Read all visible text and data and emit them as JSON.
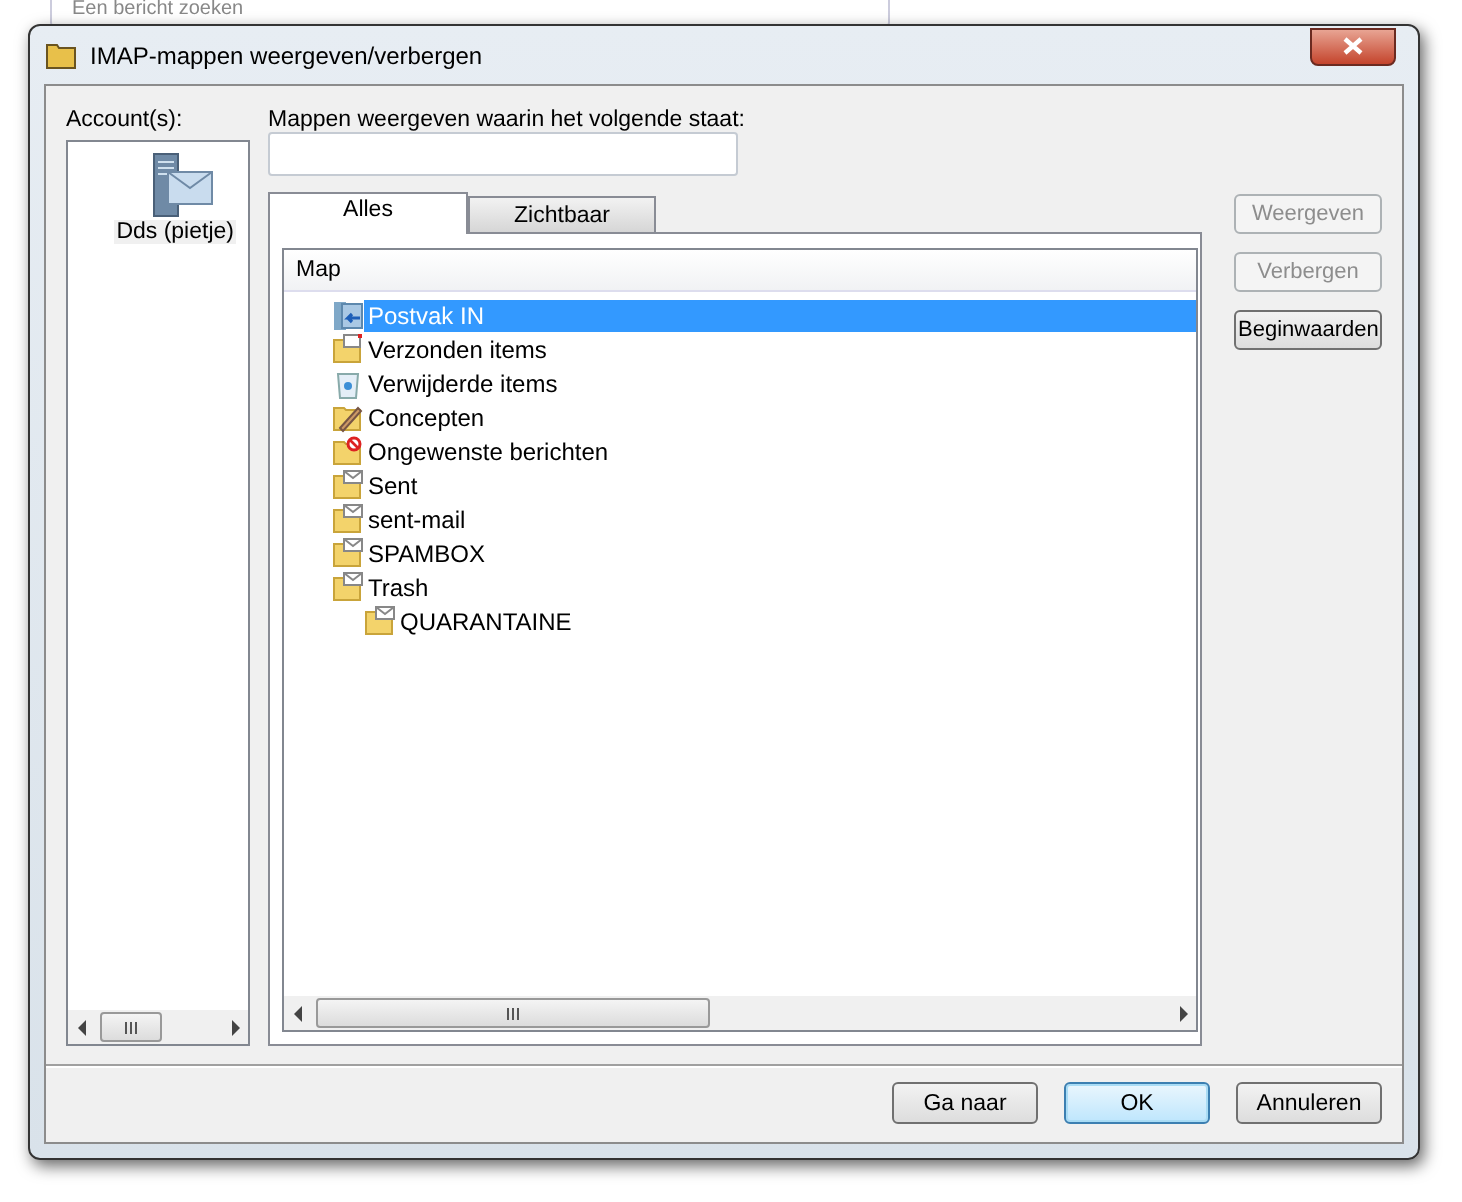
{
  "background": {
    "search_placeholder": "Een bericht zoeken"
  },
  "window": {
    "title": "IMAP-mappen weergeven/verbergen"
  },
  "accounts": {
    "label": "Account(s):",
    "items": [
      {
        "name": "Dds (pietje)",
        "selected": true
      }
    ]
  },
  "filter": {
    "label": "Mappen weergeven waarin het volgende staat:"
  },
  "tabs": [
    {
      "label": "Alles",
      "selected": true
    },
    {
      "label": "Zichtbaar",
      "selected": false
    }
  ],
  "folder_list": {
    "column": "Map",
    "folders": [
      {
        "name": "Postvak IN",
        "kind": "inbox",
        "selected": true
      },
      {
        "name": "Verzonden items",
        "kind": "sent",
        "selected": false
      },
      {
        "name": "Verwijderde items",
        "kind": "deleted",
        "selected": false
      },
      {
        "name": "Concepten",
        "kind": "drafts",
        "selected": false
      },
      {
        "name": "Ongewenste berichten",
        "kind": "junk",
        "selected": false
      },
      {
        "name": "Sent",
        "kind": "mail",
        "selected": false
      },
      {
        "name": "sent-mail",
        "kind": "mail",
        "selected": false
      },
      {
        "name": "SPAMBOX",
        "kind": "mail",
        "selected": false
      },
      {
        "name": "Trash",
        "kind": "mail",
        "selected": false,
        "children": [
          {
            "name": "QUARANTAINE",
            "kind": "mail",
            "selected": false
          }
        ]
      }
    ]
  },
  "side_buttons": [
    {
      "label": "Weergeven",
      "disabled": true
    },
    {
      "label": "Verbergen",
      "disabled": true
    },
    {
      "label": "Beginwaarden",
      "disabled": false
    }
  ],
  "buttons": [
    {
      "label": "Ga naar",
      "default": false
    },
    {
      "label": "OK",
      "default": true
    },
    {
      "label": "Annuleren",
      "default": false
    }
  ]
}
